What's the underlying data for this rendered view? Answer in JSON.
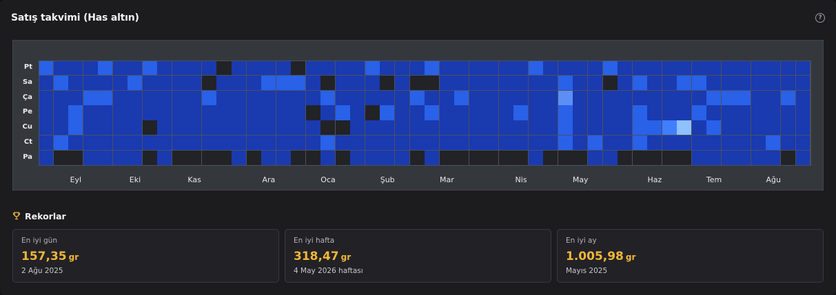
{
  "header": {
    "title": "Satış takvimi (Has altın)",
    "help_icon": "?"
  },
  "heatmap": {
    "day_labels": [
      "Pt",
      "Sa",
      "Ça",
      "Pe",
      "Cu",
      "Ct",
      "Pa"
    ],
    "month_labels": [
      {
        "label": "Eyl",
        "col": 2.5
      },
      {
        "label": "Eki",
        "col": 6.5
      },
      {
        "label": "Kas",
        "col": 10.5
      },
      {
        "label": "Ara",
        "col": 15.5
      },
      {
        "label": "Oca",
        "col": 19.5
      },
      {
        "label": "Şub",
        "col": 23.5
      },
      {
        "label": "Mar",
        "col": 27.5
      },
      {
        "label": "Nis",
        "col": 32.5
      },
      {
        "label": "May",
        "col": 36.5
      },
      {
        "label": "Haz",
        "col": 41.5
      },
      {
        "label": "Tem",
        "col": 45.5
      },
      {
        "label": "Ağu",
        "col": 49.5
      }
    ],
    "weeks": 52,
    "colors": [
      "#222326",
      "#1a3ab0",
      "#2961e8",
      "#3f7fff",
      "#5b8ff5",
      "#8fc0ff"
    ],
    "levels": [
      "2111211211110111101111211121111112111121111111111111",
      "1211112111101112221011101001111111121101211221111111",
      "1112211111121111111211111211211111141111111112221121",
      "1121111111111111110121021121111121121111211121111111",
      "1121111011111111111001111111111111121111223512111111",
      "1211111111111111111211111111111111121211211111111211",
      "1001111010000101100101111010000001000110000011111101"
    ]
  },
  "records": {
    "title": "Rekorlar",
    "items": [
      {
        "label": "En iyi gün",
        "value": "157,35",
        "unit": "gr",
        "sub": "2 Ağu 2025"
      },
      {
        "label": "En iyi hafta",
        "value": "318,47",
        "unit": "gr",
        "sub": "4 May 2026 haftası"
      },
      {
        "label": "En iyi ay",
        "value": "1.005,98",
        "unit": "gr",
        "sub": "Mayıs 2025"
      }
    ]
  }
}
